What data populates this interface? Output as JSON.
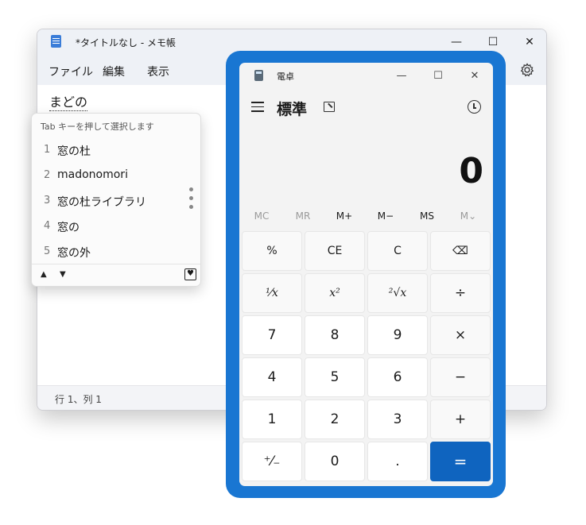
{
  "notepad": {
    "title": "*タイトルなし - メモ帳",
    "controls": {
      "minimize": "—",
      "maximize": "☐",
      "close": "✕"
    },
    "menu": [
      "ファイル",
      "編集",
      "表示"
    ],
    "settings_icon": "gear-icon",
    "content_text": "まどの",
    "status": "行 1、列 1"
  },
  "ime": {
    "hint": "Tab キーを押して選択します",
    "candidates": [
      {
        "num": "1",
        "word": "窓の杜"
      },
      {
        "num": "2",
        "word": "madonomori"
      },
      {
        "num": "3",
        "word": "窓の杜ライブラリ"
      },
      {
        "num": "4",
        "word": "窓の"
      },
      {
        "num": "5",
        "word": "窓の外"
      }
    ],
    "arrows": {
      "up": "▲",
      "down": "▼"
    },
    "heart": "♥"
  },
  "calculator": {
    "title": "電卓",
    "controls": {
      "minimize": "—",
      "maximize": "☐",
      "close": "✕"
    },
    "mode": "標準",
    "display": "0",
    "accent_color": "#0f64bf",
    "frame_color": "#1976d2",
    "memory": [
      {
        "label": "MC",
        "enabled": false
      },
      {
        "label": "MR",
        "enabled": false
      },
      {
        "label": "M+",
        "enabled": true
      },
      {
        "label": "M−",
        "enabled": true
      },
      {
        "label": "MS",
        "enabled": true
      },
      {
        "label": "M⌄",
        "enabled": false
      }
    ],
    "keys": [
      [
        "%",
        "CE",
        "C",
        "⌫"
      ],
      [
        "¹⁄x",
        "x²",
        "²√x",
        "÷"
      ],
      [
        "7",
        "8",
        "9",
        "×"
      ],
      [
        "4",
        "5",
        "6",
        "−"
      ],
      [
        "1",
        "2",
        "3",
        "+"
      ],
      [
        "⁺⁄₋",
        "0",
        ".",
        "="
      ]
    ]
  }
}
